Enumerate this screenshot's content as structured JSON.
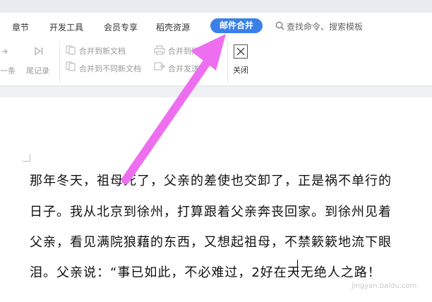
{
  "tabs": {
    "items": [
      "章节",
      "开发工具",
      "会员专享",
      "稻壳资源"
    ],
    "active": "邮件合并"
  },
  "search": {
    "label": "查找命令、搜索模板"
  },
  "ribbon": {
    "prev_label": "一条",
    "last_label": "尾记录",
    "merge_new_doc": "合并到新文档",
    "merge_diff_doc": "合并到不同新文档",
    "merge_printer": "合并到打印机",
    "merge_send": "合并发送",
    "close_label": "关闭"
  },
  "document": {
    "lines": [
      "那年冬天，祖母死了，父亲的差使也交卸了，正是祸不单行的",
      "日子。我从北京到徐州，打算跟着父亲奔丧回家。到徐州见着",
      "父亲，看见满院狼藉的东西，又想起祖母，不禁簌簌地流下眼",
      "泪。父亲说：“事已如此，不必难过，2好在天无绝人之路！"
    ]
  },
  "watermark": "jingyan.baidu.com",
  "colors": {
    "accent": "#3b80e8",
    "annotation_arrow": "#ee6ef0"
  }
}
